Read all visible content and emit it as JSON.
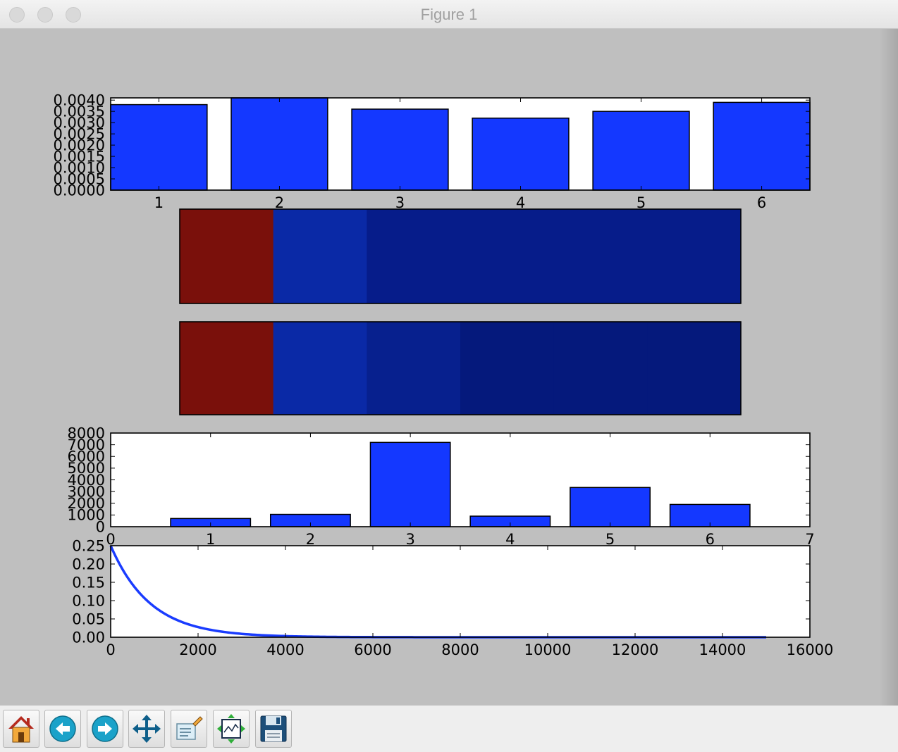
{
  "window": {
    "title": "Figure 1"
  },
  "toolbar": {
    "buttons": [
      {
        "name": "home-button",
        "icon": "home-icon"
      },
      {
        "name": "back-button",
        "icon": "back-arrow-icon"
      },
      {
        "name": "forward-button",
        "icon": "forward-arrow-icon"
      },
      {
        "name": "pan-button",
        "icon": "move-arrows-icon"
      },
      {
        "name": "zoom-button",
        "icon": "zoom-rect-icon"
      },
      {
        "name": "configure-subplots-button",
        "icon": "subplots-icon"
      },
      {
        "name": "save-button",
        "icon": "floppy-disk-icon"
      }
    ]
  },
  "colors": {
    "bar": "#1438ff",
    "line": "#1a3cff",
    "figure_bg": "#bfbfbf",
    "strip_red": "#7a100b",
    "strip_blue_1": "#0a29a6",
    "strip_blue_2": "#061c8a",
    "strip_blue_3": "#05197c"
  },
  "chart_data": [
    {
      "type": "bar",
      "x": [
        1,
        2,
        3,
        4,
        5,
        6
      ],
      "values": [
        0.0038,
        0.0041,
        0.0036,
        0.0032,
        0.0035,
        0.0039
      ],
      "ylim": [
        0,
        0.0041
      ],
      "xlim": [
        0.6,
        6.4
      ],
      "yticks": [
        "0.0000",
        "0.0005",
        "0.0010",
        "0.0015",
        "0.0020",
        "0.0025",
        "0.0030",
        "0.0035",
        "0.0040"
      ],
      "xticks": [
        "1",
        "2",
        "3",
        "4",
        "5",
        "6"
      ],
      "title": "",
      "xlabel": "",
      "ylabel": ""
    },
    {
      "type": "heatmap",
      "values": [
        1.0,
        0.14,
        0.08,
        0.08,
        0.08,
        0.08
      ],
      "colors": [
        "#7a100b",
        "#0a29a6",
        "#061c8a",
        "#061c8a",
        "#061c8a",
        "#061c8a"
      ],
      "title": "",
      "xlabel": "",
      "ylabel": ""
    },
    {
      "type": "heatmap",
      "values": [
        1.0,
        0.14,
        0.1,
        0.07,
        0.07,
        0.07
      ],
      "colors": [
        "#7a100b",
        "#0a29a6",
        "#07208e",
        "#05197c",
        "#05197c",
        "#05197c"
      ],
      "title": "",
      "xlabel": "",
      "ylabel": ""
    },
    {
      "type": "bar",
      "x": [
        1,
        2,
        3,
        4,
        5,
        6
      ],
      "values": [
        700,
        1050,
        7200,
        900,
        3350,
        1900
      ],
      "ylim": [
        0,
        8000
      ],
      "xlim": [
        0,
        7
      ],
      "yticks": [
        "0",
        "1000",
        "2000",
        "3000",
        "4000",
        "5000",
        "6000",
        "7000",
        "8000"
      ],
      "xticks": [
        "0",
        "1",
        "2",
        "3",
        "4",
        "5",
        "6",
        "7"
      ],
      "title": "",
      "xlabel": "",
      "ylabel": ""
    },
    {
      "type": "line",
      "series": [
        {
          "x0": 0,
          "x1": 15000,
          "y0": 0.25,
          "decay_per_x": 0.0011
        }
      ],
      "ylim": [
        0,
        0.25
      ],
      "xlim": [
        0,
        16000
      ],
      "yticks": [
        "0.00",
        "0.05",
        "0.10",
        "0.15",
        "0.20",
        "0.25"
      ],
      "xticks": [
        "0",
        "2000",
        "4000",
        "6000",
        "8000",
        "10000",
        "12000",
        "14000",
        "16000"
      ],
      "title": "",
      "xlabel": "",
      "ylabel": ""
    }
  ]
}
